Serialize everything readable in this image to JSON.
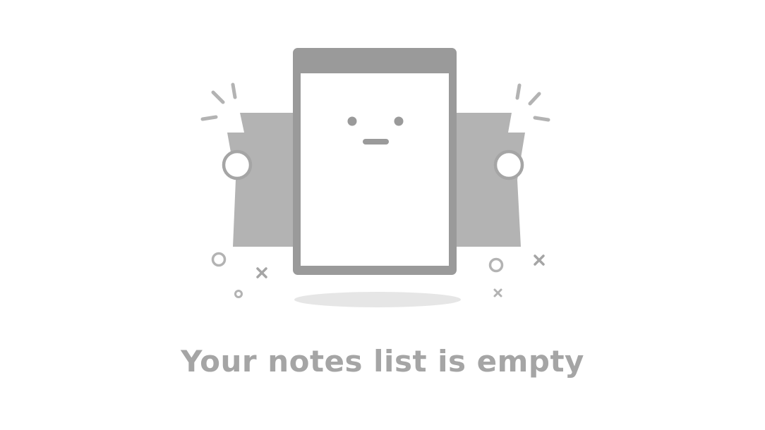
{
  "empty_state": {
    "message": "Your notes list is empty",
    "illustration_icon": "notepad-holding-banner-icon"
  },
  "colors": {
    "background": "#ffffff",
    "text": "#a5a5a5",
    "illustration_dark": "#9a9a9a",
    "illustration_light": "#b3b3b3",
    "shadow": "#e6e6e6"
  }
}
